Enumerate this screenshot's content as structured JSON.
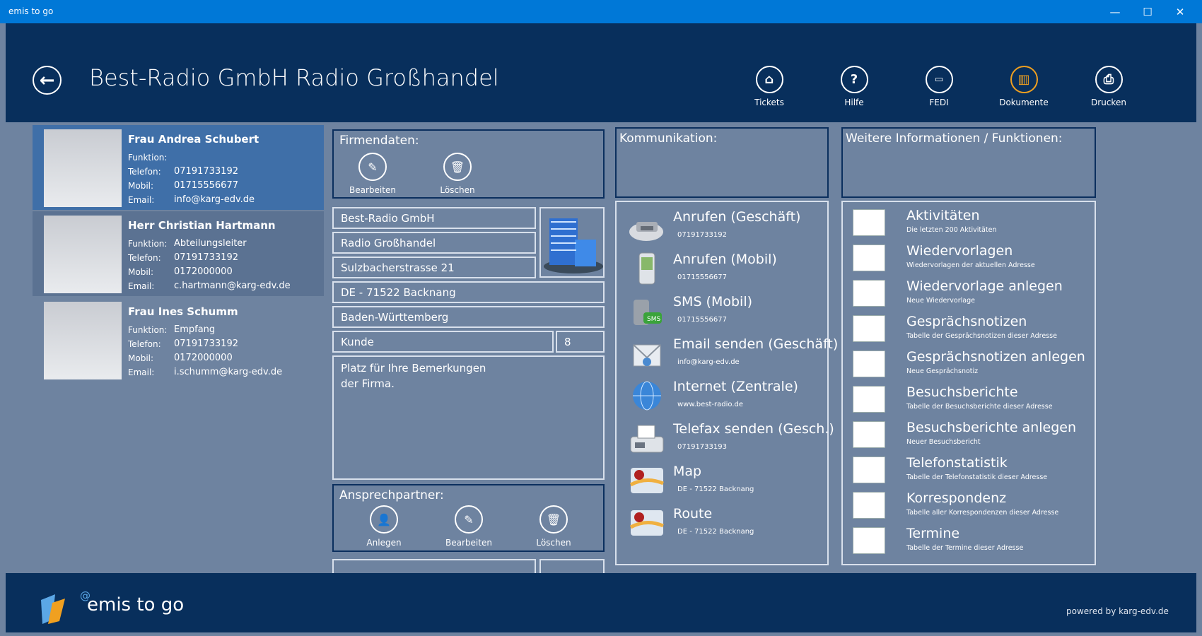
{
  "window": {
    "title": "emis to go",
    "minimize": "—",
    "maximize": "☐",
    "close": "✕"
  },
  "header": {
    "title": "Best-Radio GmbH Radio Großhandel",
    "toolbar": [
      {
        "label": "Tickets",
        "icon": "tag-icon"
      },
      {
        "label": "Hilfe",
        "icon": "help-icon"
      },
      {
        "label": "FEDI",
        "icon": "computer-icon"
      },
      {
        "label": "Dokumente",
        "icon": "books-icon"
      },
      {
        "label": "Drucken",
        "icon": "print-icon"
      }
    ]
  },
  "contacts": [
    {
      "name": "Frau Andrea Schubert",
      "funktion_label": "Funktion:",
      "funktion": "",
      "telefon_label": "Telefon:",
      "telefon": "07191733192",
      "mobil_label": "Mobil:",
      "mobil": "01715556677",
      "email_label": "Email:",
      "email": "info@karg-edv.de"
    },
    {
      "name": "Herr Christian Hartmann",
      "funktion_label": "Funktion:",
      "funktion": "Abteilungsleiter",
      "telefon_label": "Telefon:",
      "telefon": "07191733192",
      "mobil_label": "Mobil:",
      "mobil": "0172000000",
      "email_label": "Email:",
      "email": "c.hartmann@karg-edv.de"
    },
    {
      "name": "Frau Ines Schumm",
      "funktion_label": "Funktion:",
      "funktion": "Empfang",
      "telefon_label": "Telefon:",
      "telefon": "07191733192",
      "mobil_label": "Mobil:",
      "mobil": "0172000000",
      "email_label": "Email:",
      "email": "i.schumm@karg-edv.de"
    }
  ],
  "firmendaten": {
    "title": "Firmendaten:",
    "edit": "Bearbeiten",
    "delete": "Löschen",
    "name": "Best-Radio GmbH",
    "zusatz": "Radio Großhandel",
    "strasse": "Sulzbacherstrasse 21",
    "ort": "DE - 71522 Backnang",
    "land": "Baden-Württemberg",
    "typ": "Kunde",
    "nummer": "8",
    "bemerkung_line1": "Platz für Ihre Bemerkungen",
    "bemerkung_line2": "der Firma."
  },
  "ansprechpartner": {
    "title": "Ansprechpartner:",
    "add": "Anlegen",
    "edit": "Bearbeiten",
    "delete": "Löschen"
  },
  "kommunikation": {
    "title": "Kommunikation:",
    "items": [
      {
        "title": "Anrufen (Geschäft)",
        "sub": "07191733192",
        "icon": "phone-icon"
      },
      {
        "title": "Anrufen (Mobil)",
        "sub": "01715556677",
        "icon": "mobile-phone-icon"
      },
      {
        "title": "SMS (Mobil)",
        "sub": "01715556677",
        "icon": "sms-icon"
      },
      {
        "title": "Email senden (Geschäft)",
        "sub": "info@karg-edv.de",
        "icon": "email-icon"
      },
      {
        "title": "Internet (Zentrale)",
        "sub": "www.best-radio.de",
        "icon": "globe-icon"
      },
      {
        "title": "Telefax senden (Gesch.)",
        "sub": "07191733193",
        "icon": "fax-icon"
      },
      {
        "title": "Map",
        "sub": "DE - 71522 Backnang",
        "icon": "map-icon"
      },
      {
        "title": "Route",
        "sub": "DE - 71522 Backnang",
        "icon": "route-icon"
      }
    ]
  },
  "weitere": {
    "title": "Weitere Informationen / Funktionen:",
    "items": [
      {
        "title": "Aktivitäten",
        "sub": "Die letzten 200 Aktivitäten"
      },
      {
        "title": "Wiedervorlagen",
        "sub": "Wiedervorlagen der aktuellen Adresse"
      },
      {
        "title": "Wiedervorlage anlegen",
        "sub": "Neue Wiedervorlage"
      },
      {
        "title": "Gesprächsnotizen",
        "sub": "Tabelle der Gesprächsnotizen dieser Adresse"
      },
      {
        "title": "Gesprächsnotizen anlegen",
        "sub": "Neue Gesprächsnotiz"
      },
      {
        "title": "Besuchsberichte",
        "sub": "Tabelle der Besuchsberichte dieser Adresse"
      },
      {
        "title": "Besuchsberichte anlegen",
        "sub": "Neuer Besuchsbericht"
      },
      {
        "title": "Telefonstatistik",
        "sub": "Tabelle der Telefonstatistik dieser Adresse"
      },
      {
        "title": "Korrespondenz",
        "sub": "Tabelle aller Korrespondenzen dieser Adresse"
      },
      {
        "title": "Termine",
        "sub": "Tabelle der Termine dieser Adresse"
      }
    ]
  },
  "footer": {
    "logo_text": "emis to go",
    "powered": "powered by karg-edv.de"
  },
  "colors": {
    "titlebar": "#0078d7",
    "header": "#082f5c",
    "body": "#6e83a0",
    "selected": "#3f6fa8",
    "hovered": "#5b7292"
  }
}
